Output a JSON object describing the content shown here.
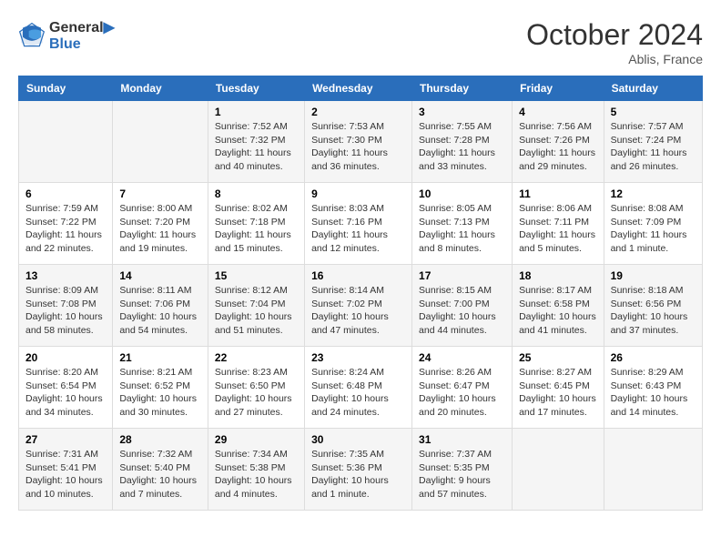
{
  "header": {
    "logo_line1": "General",
    "logo_line2": "Blue",
    "month": "October 2024",
    "location": "Ablis, France"
  },
  "days_of_week": [
    "Sunday",
    "Monday",
    "Tuesday",
    "Wednesday",
    "Thursday",
    "Friday",
    "Saturday"
  ],
  "weeks": [
    [
      {
        "day": "",
        "sunrise": "",
        "sunset": "",
        "daylight": ""
      },
      {
        "day": "",
        "sunrise": "",
        "sunset": "",
        "daylight": ""
      },
      {
        "day": "1",
        "sunrise": "Sunrise: 7:52 AM",
        "sunset": "Sunset: 7:32 PM",
        "daylight": "Daylight: 11 hours and 40 minutes."
      },
      {
        "day": "2",
        "sunrise": "Sunrise: 7:53 AM",
        "sunset": "Sunset: 7:30 PM",
        "daylight": "Daylight: 11 hours and 36 minutes."
      },
      {
        "day": "3",
        "sunrise": "Sunrise: 7:55 AM",
        "sunset": "Sunset: 7:28 PM",
        "daylight": "Daylight: 11 hours and 33 minutes."
      },
      {
        "day": "4",
        "sunrise": "Sunrise: 7:56 AM",
        "sunset": "Sunset: 7:26 PM",
        "daylight": "Daylight: 11 hours and 29 minutes."
      },
      {
        "day": "5",
        "sunrise": "Sunrise: 7:57 AM",
        "sunset": "Sunset: 7:24 PM",
        "daylight": "Daylight: 11 hours and 26 minutes."
      }
    ],
    [
      {
        "day": "6",
        "sunrise": "Sunrise: 7:59 AM",
        "sunset": "Sunset: 7:22 PM",
        "daylight": "Daylight: 11 hours and 22 minutes."
      },
      {
        "day": "7",
        "sunrise": "Sunrise: 8:00 AM",
        "sunset": "Sunset: 7:20 PM",
        "daylight": "Daylight: 11 hours and 19 minutes."
      },
      {
        "day": "8",
        "sunrise": "Sunrise: 8:02 AM",
        "sunset": "Sunset: 7:18 PM",
        "daylight": "Daylight: 11 hours and 15 minutes."
      },
      {
        "day": "9",
        "sunrise": "Sunrise: 8:03 AM",
        "sunset": "Sunset: 7:16 PM",
        "daylight": "Daylight: 11 hours and 12 minutes."
      },
      {
        "day": "10",
        "sunrise": "Sunrise: 8:05 AM",
        "sunset": "Sunset: 7:13 PM",
        "daylight": "Daylight: 11 hours and 8 minutes."
      },
      {
        "day": "11",
        "sunrise": "Sunrise: 8:06 AM",
        "sunset": "Sunset: 7:11 PM",
        "daylight": "Daylight: 11 hours and 5 minutes."
      },
      {
        "day": "12",
        "sunrise": "Sunrise: 8:08 AM",
        "sunset": "Sunset: 7:09 PM",
        "daylight": "Daylight: 11 hours and 1 minute."
      }
    ],
    [
      {
        "day": "13",
        "sunrise": "Sunrise: 8:09 AM",
        "sunset": "Sunset: 7:08 PM",
        "daylight": "Daylight: 10 hours and 58 minutes."
      },
      {
        "day": "14",
        "sunrise": "Sunrise: 8:11 AM",
        "sunset": "Sunset: 7:06 PM",
        "daylight": "Daylight: 10 hours and 54 minutes."
      },
      {
        "day": "15",
        "sunrise": "Sunrise: 8:12 AM",
        "sunset": "Sunset: 7:04 PM",
        "daylight": "Daylight: 10 hours and 51 minutes."
      },
      {
        "day": "16",
        "sunrise": "Sunrise: 8:14 AM",
        "sunset": "Sunset: 7:02 PM",
        "daylight": "Daylight: 10 hours and 47 minutes."
      },
      {
        "day": "17",
        "sunrise": "Sunrise: 8:15 AM",
        "sunset": "Sunset: 7:00 PM",
        "daylight": "Daylight: 10 hours and 44 minutes."
      },
      {
        "day": "18",
        "sunrise": "Sunrise: 8:17 AM",
        "sunset": "Sunset: 6:58 PM",
        "daylight": "Daylight: 10 hours and 41 minutes."
      },
      {
        "day": "19",
        "sunrise": "Sunrise: 8:18 AM",
        "sunset": "Sunset: 6:56 PM",
        "daylight": "Daylight: 10 hours and 37 minutes."
      }
    ],
    [
      {
        "day": "20",
        "sunrise": "Sunrise: 8:20 AM",
        "sunset": "Sunset: 6:54 PM",
        "daylight": "Daylight: 10 hours and 34 minutes."
      },
      {
        "day": "21",
        "sunrise": "Sunrise: 8:21 AM",
        "sunset": "Sunset: 6:52 PM",
        "daylight": "Daylight: 10 hours and 30 minutes."
      },
      {
        "day": "22",
        "sunrise": "Sunrise: 8:23 AM",
        "sunset": "Sunset: 6:50 PM",
        "daylight": "Daylight: 10 hours and 27 minutes."
      },
      {
        "day": "23",
        "sunrise": "Sunrise: 8:24 AM",
        "sunset": "Sunset: 6:48 PM",
        "daylight": "Daylight: 10 hours and 24 minutes."
      },
      {
        "day": "24",
        "sunrise": "Sunrise: 8:26 AM",
        "sunset": "Sunset: 6:47 PM",
        "daylight": "Daylight: 10 hours and 20 minutes."
      },
      {
        "day": "25",
        "sunrise": "Sunrise: 8:27 AM",
        "sunset": "Sunset: 6:45 PM",
        "daylight": "Daylight: 10 hours and 17 minutes."
      },
      {
        "day": "26",
        "sunrise": "Sunrise: 8:29 AM",
        "sunset": "Sunset: 6:43 PM",
        "daylight": "Daylight: 10 hours and 14 minutes."
      }
    ],
    [
      {
        "day": "27",
        "sunrise": "Sunrise: 7:31 AM",
        "sunset": "Sunset: 5:41 PM",
        "daylight": "Daylight: 10 hours and 10 minutes."
      },
      {
        "day": "28",
        "sunrise": "Sunrise: 7:32 AM",
        "sunset": "Sunset: 5:40 PM",
        "daylight": "Daylight: 10 hours and 7 minutes."
      },
      {
        "day": "29",
        "sunrise": "Sunrise: 7:34 AM",
        "sunset": "Sunset: 5:38 PM",
        "daylight": "Daylight: 10 hours and 4 minutes."
      },
      {
        "day": "30",
        "sunrise": "Sunrise: 7:35 AM",
        "sunset": "Sunset: 5:36 PM",
        "daylight": "Daylight: 10 hours and 1 minute."
      },
      {
        "day": "31",
        "sunrise": "Sunrise: 7:37 AM",
        "sunset": "Sunset: 5:35 PM",
        "daylight": "Daylight: 9 hours and 57 minutes."
      },
      {
        "day": "",
        "sunrise": "",
        "sunset": "",
        "daylight": ""
      },
      {
        "day": "",
        "sunrise": "",
        "sunset": "",
        "daylight": ""
      }
    ]
  ]
}
